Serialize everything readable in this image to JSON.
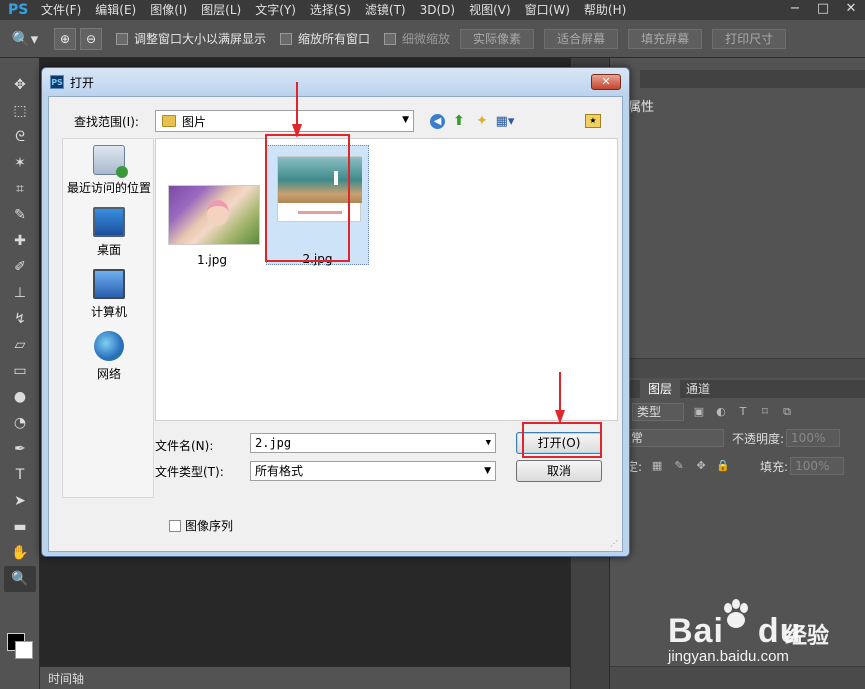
{
  "app": {
    "logo": "PS",
    "menu": [
      "文件(F)",
      "编辑(E)",
      "图像(I)",
      "图层(L)",
      "文字(Y)",
      "选择(S)",
      "滤镜(T)",
      "3D(D)",
      "视图(V)",
      "窗口(W)",
      "帮助(H)"
    ],
    "window_controls": [
      "−",
      "□",
      "✕"
    ]
  },
  "options_bar": {
    "resize_windows": "调整窗口大小以满屏显示",
    "zoom_all": "缩放所有窗口",
    "scrubby_zoom": "细微缩放",
    "actual_pixels": "实际像素",
    "fit_screen": "适合屏幕",
    "fill_screen": "填充屏幕",
    "print_size": "打印尺寸"
  },
  "tools": [
    "move-tool",
    "marquee-tool",
    "lasso-tool",
    "magic-wand-tool",
    "crop-tool",
    "eyedropper-tool",
    "healing-tool",
    "brush-tool",
    "stamp-tool",
    "history-brush-tool",
    "eraser-tool",
    "gradient-tool",
    "blur-tool",
    "dodge-tool",
    "pen-tool",
    "type-tool",
    "path-select-tool",
    "shape-tool",
    "hand-tool",
    "zoom-tool"
  ],
  "timeline_label": "时间轴",
  "right_panel": {
    "properties_tab": "性",
    "properties_title": "属性",
    "layers_tab": "图层",
    "channels_tab": "通道",
    "kind_label": "类型",
    "blend_mode": "常",
    "opacity_label": "不透明度:",
    "opacity_value": "100%",
    "lock_label": "定:",
    "fill_label": "填充:",
    "fill_value": "100%"
  },
  "dialog": {
    "title": "打开",
    "close": "✕",
    "look_in_label": "查找范围(I):",
    "look_in_value": "图片",
    "places": [
      {
        "label": "最近访问的位置",
        "icon": "recent-places-icon"
      },
      {
        "label": "桌面",
        "icon": "desktop-icon"
      },
      {
        "label": "计算机",
        "icon": "computer-icon"
      },
      {
        "label": "网络",
        "icon": "network-icon"
      }
    ],
    "files": [
      {
        "name": "1.jpg",
        "selected": false
      },
      {
        "name": "2.jpg",
        "selected": true
      }
    ],
    "filename_label": "文件名(N):",
    "filename_value": "2.jpg",
    "filetype_label": "文件类型(T):",
    "filetype_value": "所有格式",
    "open_button": "打开(O)",
    "cancel_button": "取消",
    "image_sequence": "图像序列"
  },
  "watermark": {
    "brand": "Bai",
    "brand_end": "du",
    "cn": "经验",
    "url": "jingyan.baidu.com"
  },
  "colors": {
    "annotation_red": "#e0262a",
    "ps_dark": "#535353",
    "dialog_frame": "#bcd3ee"
  }
}
